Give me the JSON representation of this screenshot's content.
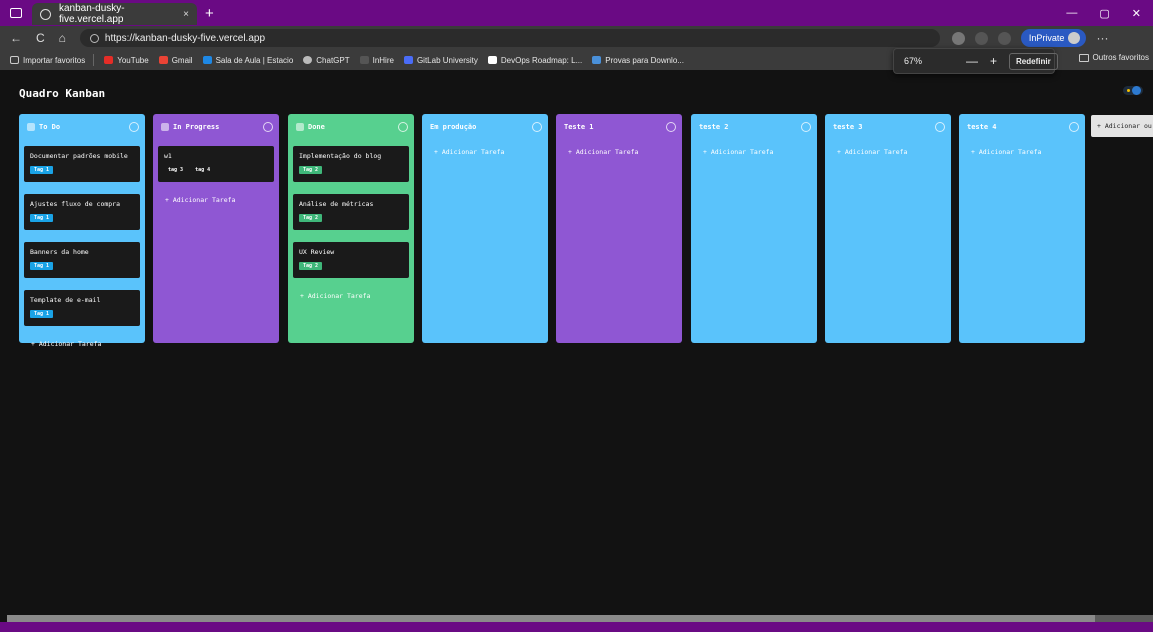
{
  "browser": {
    "tab_title": "kanban-dusky-five.vercel.app",
    "tab_close": "×",
    "new_tab": "+",
    "window_controls": [
      "—",
      "▢",
      "✕"
    ],
    "nav_back": "←",
    "nav_reload": "C",
    "nav_home": "⌂",
    "url": "https://kanban-dusky-five.vercel.app",
    "inprivate_label": "InPrivate",
    "favorites": [
      {
        "label": "Importar favoritos",
        "color": "#cfcfcf"
      },
      {
        "label": "YouTube",
        "color": "#e52d27"
      },
      {
        "label": "Gmail",
        "color": "#ea4335"
      },
      {
        "label": "Sala de Aula | Estacio",
        "color": "#1e88e5"
      },
      {
        "label": "ChatGPT",
        "color": "#bbbbbb"
      },
      {
        "label": "InHire",
        "color": "#555555"
      },
      {
        "label": "GitLab University",
        "color": "#4a6cf7"
      },
      {
        "label": "DevOps Roadmap: L...",
        "color": "#ffffff"
      },
      {
        "label": "Provas para Downlo...",
        "color": "#4a90d9"
      }
    ],
    "other_favorites": "Outros favoritos",
    "zoom": {
      "value": "67%",
      "minus": "—",
      "plus": "+",
      "reset_label": "Redefinir"
    }
  },
  "board": {
    "title": "Quadro Kanban",
    "add_column_label": "+ Adicionar ou",
    "add_task_label": "+ Adicionar Tarefa",
    "colors": {
      "blue": "#5ac3fb",
      "purple": "#8f57d3",
      "green": "#57d08f",
      "tag_blue": "#1aa3e6",
      "tag_green": "#3fb77a"
    },
    "columns": [
      {
        "title": "To Do",
        "color": "#5ac3fb",
        "icon": "clipboard-icon",
        "cards": [
          {
            "title": "Documentar padrões mobile",
            "tags": [
              {
                "label": "Tag 1",
                "color": "#1aa3e6"
              }
            ]
          },
          {
            "title": "Ajustes fluxo de compra",
            "tags": [
              {
                "label": "Tag 1",
                "color": "#1aa3e6"
              }
            ]
          },
          {
            "title": "Banners da home",
            "tags": [
              {
                "label": "Tag 1",
                "color": "#1aa3e6"
              }
            ]
          },
          {
            "title": "Template de e-mail",
            "tags": [
              {
                "label": "Tag 1",
                "color": "#1aa3e6"
              }
            ]
          }
        ]
      },
      {
        "title": "In Progress",
        "color": "#8f57d3",
        "icon": "user-icon",
        "cards": [
          {
            "title": "w1",
            "tags": [
              {
                "label": "tag 3",
                "color": "transparent"
              },
              {
                "label": "tag 4",
                "color": "transparent"
              }
            ]
          }
        ]
      },
      {
        "title": "Done",
        "color": "#57d08f",
        "icon": "sparkle-icon",
        "cards": [
          {
            "title": "Implementação do blog",
            "tags": [
              {
                "label": "Tag 2",
                "color": "#3fb77a"
              }
            ]
          },
          {
            "title": "Análise de métricas",
            "tags": [
              {
                "label": "Tag 2",
                "color": "#3fb77a"
              }
            ]
          },
          {
            "title": "UX Review",
            "tags": [
              {
                "label": "Tag 2",
                "color": "#3fb77a"
              }
            ]
          }
        ]
      },
      {
        "title": "Em produção",
        "color": "#5ac3fb",
        "icon": "",
        "cards": []
      },
      {
        "title": "Teste 1",
        "color": "#8f57d3",
        "icon": "",
        "cards": []
      },
      {
        "title": "teste 2",
        "color": "#5ac3fb",
        "icon": "",
        "cards": []
      },
      {
        "title": "teste 3",
        "color": "#5ac3fb",
        "icon": "",
        "cards": []
      },
      {
        "title": "teste 4",
        "color": "#5ac3fb",
        "icon": "",
        "cards": []
      }
    ]
  }
}
